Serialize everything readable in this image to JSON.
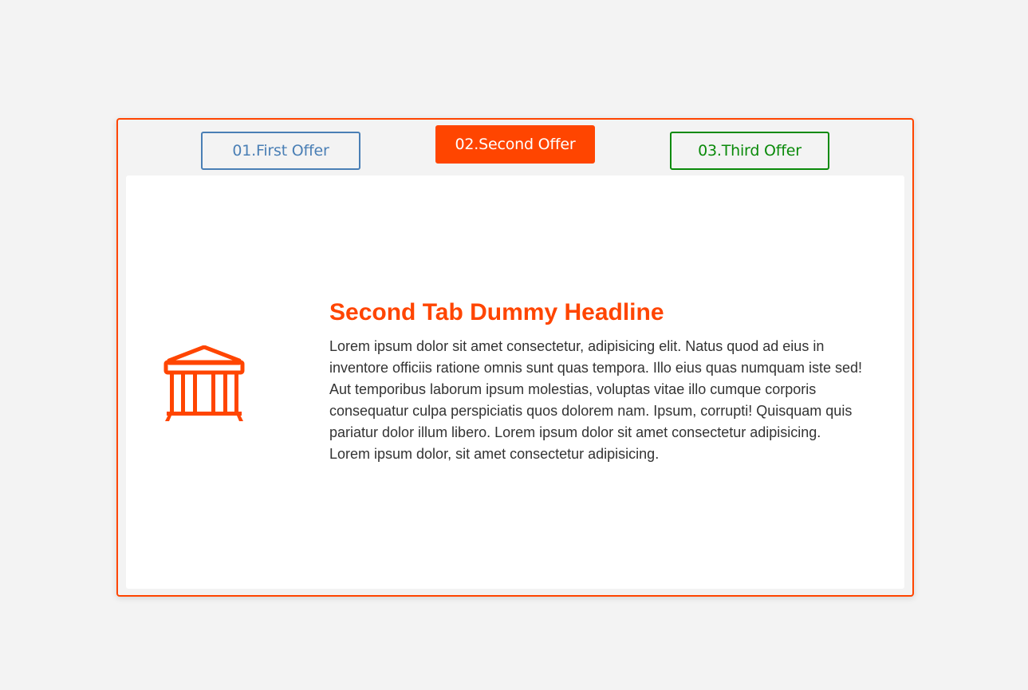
{
  "tabs": [
    {
      "label": "01.First Offer",
      "color": "#4a7fb5",
      "active": false
    },
    {
      "label": "02.Second Offer",
      "color": "#ff4500",
      "active": true
    },
    {
      "label": "03.Third Offer",
      "color": "#0a8a0a",
      "active": false
    }
  ],
  "panel": {
    "icon": "bank-building-icon",
    "title": "Second Tab Dummy Headline",
    "body": "Lorem ipsum dolor sit amet consectetur, adipisicing elit. Natus quod ad eius in inventore officiis ratione omnis sunt quas tempora. Illo eius quas numquam iste sed! Aut temporibus laborum ipsum molestias, voluptas vitae illo cumque corporis consequatur culpa perspiciatis quos dolorem nam. Ipsum, corrupti! Quisquam quis pariatur dolor illum libero. Lorem ipsum dolor sit amet consectetur adipisicing. Lorem ipsum dolor, sit amet consectetur adipisicing."
  },
  "colors": {
    "accent": "#ff4500",
    "background": "#f3f3f3",
    "panel": "#ffffff",
    "text": "#333333"
  }
}
